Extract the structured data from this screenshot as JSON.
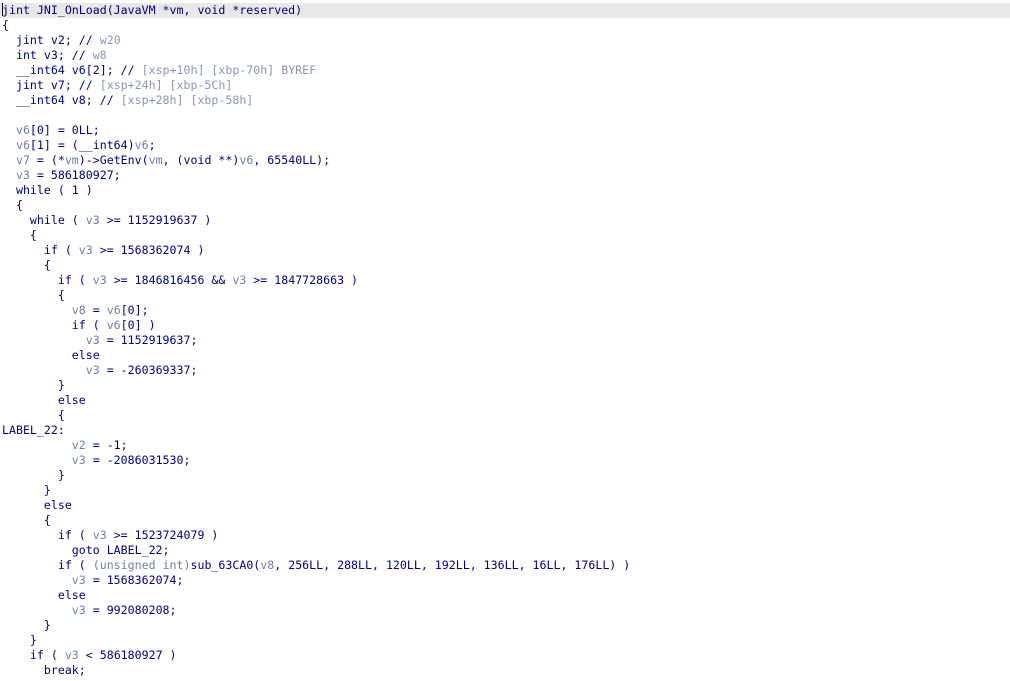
{
  "window": {
    "view": "Pseudocode",
    "current_line": 0
  },
  "colors": {
    "code": "#000080",
    "variable": "#6e7ea8",
    "comment": "#8a95b6",
    "current_line_highlight": "#e8e8e8",
    "background": "#ffffff"
  },
  "lines": [
    {
      "spans": [
        {
          "t": "code",
          "v": "jint JNI_OnLoad(JavaVM *vm, void *reserved)"
        }
      ]
    },
    {
      "spans": [
        {
          "t": "code",
          "v": "{"
        }
      ]
    },
    {
      "spans": [
        {
          "t": "code",
          "v": "  jint v2; // "
        },
        {
          "t": "com",
          "v": "w20"
        }
      ]
    },
    {
      "spans": [
        {
          "t": "code",
          "v": "  int v3; // "
        },
        {
          "t": "com",
          "v": "w8"
        }
      ]
    },
    {
      "spans": [
        {
          "t": "code",
          "v": "  __int64 v6[2]; // "
        },
        {
          "t": "com",
          "v": "[xsp+10h] [xbp-70h] BYREF"
        }
      ]
    },
    {
      "spans": [
        {
          "t": "code",
          "v": "  jint v7; // "
        },
        {
          "t": "com",
          "v": "[xsp+24h] [xbp-5Ch]"
        }
      ]
    },
    {
      "spans": [
        {
          "t": "code",
          "v": "  __int64 v8; // "
        },
        {
          "t": "com",
          "v": "[xsp+28h] [xbp-58h]"
        }
      ]
    },
    {
      "spans": []
    },
    {
      "spans": [
        {
          "t": "var",
          "v": "  v6"
        },
        {
          "t": "code",
          "v": "[0] = 0LL;"
        }
      ]
    },
    {
      "spans": [
        {
          "t": "var",
          "v": "  v6"
        },
        {
          "t": "code",
          "v": "[1] = (__int64)"
        },
        {
          "t": "var",
          "v": "v6"
        },
        {
          "t": "code",
          "v": ";"
        }
      ]
    },
    {
      "spans": [
        {
          "t": "var",
          "v": "  v7"
        },
        {
          "t": "code",
          "v": " = (*"
        },
        {
          "t": "var",
          "v": "vm"
        },
        {
          "t": "code",
          "v": ")->GetEnv("
        },
        {
          "t": "var",
          "v": "vm"
        },
        {
          "t": "code",
          "v": ", (void **)"
        },
        {
          "t": "var",
          "v": "v6"
        },
        {
          "t": "code",
          "v": ", 65540LL);"
        }
      ]
    },
    {
      "spans": [
        {
          "t": "var",
          "v": "  v3"
        },
        {
          "t": "code",
          "v": " = 586180927;"
        }
      ]
    },
    {
      "spans": [
        {
          "t": "code",
          "v": "  while ( 1 )"
        }
      ]
    },
    {
      "spans": [
        {
          "t": "code",
          "v": "  {"
        }
      ]
    },
    {
      "spans": [
        {
          "t": "code",
          "v": "    while ( "
        },
        {
          "t": "var",
          "v": "v3"
        },
        {
          "t": "code",
          "v": " >= 1152919637 )"
        }
      ]
    },
    {
      "spans": [
        {
          "t": "code",
          "v": "    {"
        }
      ]
    },
    {
      "spans": [
        {
          "t": "code",
          "v": "      if ( "
        },
        {
          "t": "var",
          "v": "v3"
        },
        {
          "t": "code",
          "v": " >= 1568362074 )"
        }
      ]
    },
    {
      "spans": [
        {
          "t": "code",
          "v": "      {"
        }
      ]
    },
    {
      "spans": [
        {
          "t": "code",
          "v": "        if ( "
        },
        {
          "t": "var",
          "v": "v3"
        },
        {
          "t": "code",
          "v": " >= 1846816456 && "
        },
        {
          "t": "var",
          "v": "v3"
        },
        {
          "t": "code",
          "v": " >= 1847728663 )"
        }
      ]
    },
    {
      "spans": [
        {
          "t": "code",
          "v": "        {"
        }
      ]
    },
    {
      "spans": [
        {
          "t": "var",
          "v": "          v8"
        },
        {
          "t": "code",
          "v": " = "
        },
        {
          "t": "var",
          "v": "v6"
        },
        {
          "t": "code",
          "v": "[0];"
        }
      ]
    },
    {
      "spans": [
        {
          "t": "code",
          "v": "          if ( "
        },
        {
          "t": "var",
          "v": "v6"
        },
        {
          "t": "code",
          "v": "[0] )"
        }
      ]
    },
    {
      "spans": [
        {
          "t": "var",
          "v": "            v3"
        },
        {
          "t": "code",
          "v": " = 1152919637;"
        }
      ]
    },
    {
      "spans": [
        {
          "t": "code",
          "v": "          else"
        }
      ]
    },
    {
      "spans": [
        {
          "t": "var",
          "v": "            v3"
        },
        {
          "t": "code",
          "v": " = -260369337;"
        }
      ]
    },
    {
      "spans": [
        {
          "t": "code",
          "v": "        }"
        }
      ]
    },
    {
      "spans": [
        {
          "t": "code",
          "v": "        else"
        }
      ]
    },
    {
      "spans": [
        {
          "t": "code",
          "v": "        {"
        }
      ]
    },
    {
      "spans": [
        {
          "t": "lbl",
          "v": "LABEL_22:"
        }
      ]
    },
    {
      "spans": [
        {
          "t": "var",
          "v": "          v2"
        },
        {
          "t": "code",
          "v": " = -1;"
        }
      ]
    },
    {
      "spans": [
        {
          "t": "var",
          "v": "          v3"
        },
        {
          "t": "code",
          "v": " = -2086031530;"
        }
      ]
    },
    {
      "spans": [
        {
          "t": "code",
          "v": "        }"
        }
      ]
    },
    {
      "spans": [
        {
          "t": "code",
          "v": "      }"
        }
      ]
    },
    {
      "spans": [
        {
          "t": "code",
          "v": "      else"
        }
      ]
    },
    {
      "spans": [
        {
          "t": "code",
          "v": "      {"
        }
      ]
    },
    {
      "spans": [
        {
          "t": "code",
          "v": "        if ( "
        },
        {
          "t": "var",
          "v": "v3"
        },
        {
          "t": "code",
          "v": " >= 1523724079 )"
        }
      ]
    },
    {
      "spans": [
        {
          "t": "code",
          "v": "          goto LABEL_22;"
        }
      ]
    },
    {
      "spans": [
        {
          "t": "code",
          "v": "        if ( "
        },
        {
          "t": "var",
          "v": "(unsigned int)"
        },
        {
          "t": "code",
          "v": "sub_63CA0("
        },
        {
          "t": "var",
          "v": "v8"
        },
        {
          "t": "code",
          "v": ", 256LL, 288LL, 120LL, 192LL, 136LL, 16LL, 176LL) )"
        }
      ]
    },
    {
      "spans": [
        {
          "t": "var",
          "v": "          v3"
        },
        {
          "t": "code",
          "v": " = 1568362074;"
        }
      ]
    },
    {
      "spans": [
        {
          "t": "code",
          "v": "        else"
        }
      ]
    },
    {
      "spans": [
        {
          "t": "var",
          "v": "          v3"
        },
        {
          "t": "code",
          "v": " = 992080208;"
        }
      ]
    },
    {
      "spans": [
        {
          "t": "code",
          "v": "      }"
        }
      ]
    },
    {
      "spans": [
        {
          "t": "code",
          "v": "    }"
        }
      ]
    },
    {
      "spans": [
        {
          "t": "code",
          "v": "    if ( "
        },
        {
          "t": "var",
          "v": "v3"
        },
        {
          "t": "code",
          "v": " < 586180927 )"
        }
      ]
    },
    {
      "spans": [
        {
          "t": "code",
          "v": "      break;"
        }
      ]
    }
  ]
}
